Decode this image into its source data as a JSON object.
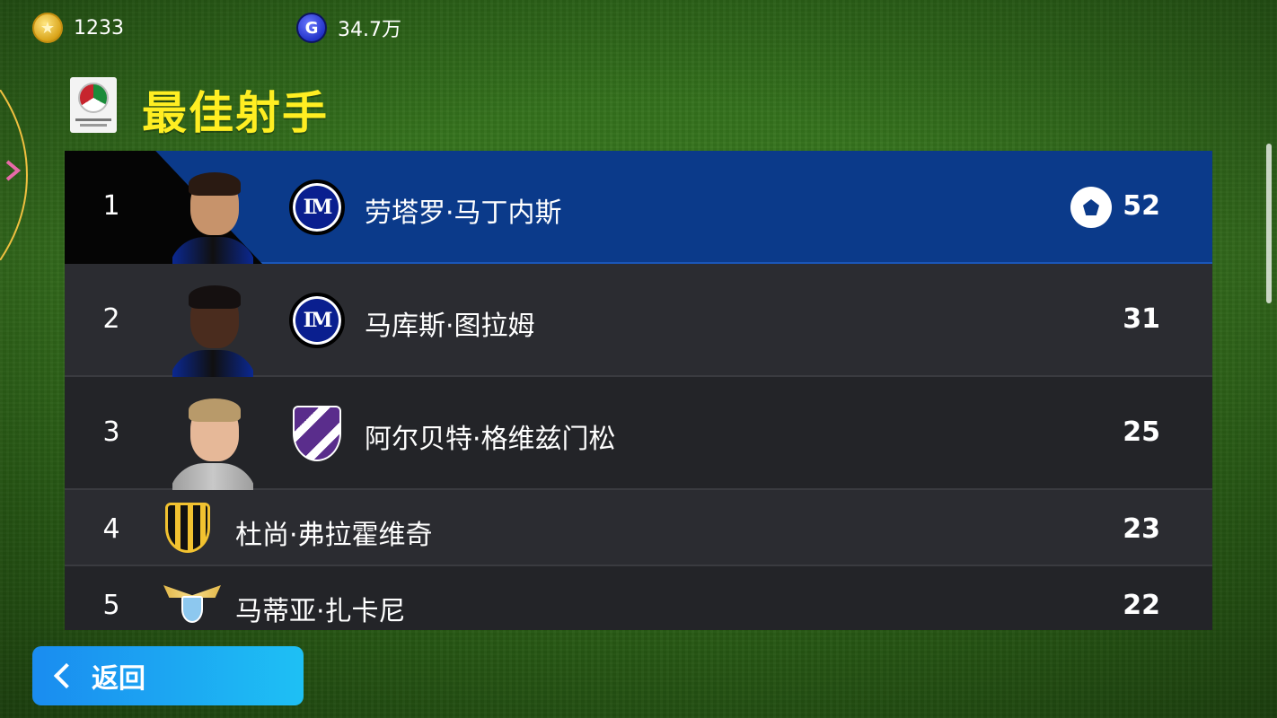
{
  "currency": {
    "gold_coins": "1233",
    "gp": "34.7万"
  },
  "header": {
    "title": "最佳射手",
    "league_logo_icon": "serie-a-logo-icon"
  },
  "table": {
    "rows": [
      {
        "rank": "1",
        "name": "劳塔罗·马丁内斯",
        "goals": "52",
        "club_icon": "inter-badge-icon",
        "highlighted": true
      },
      {
        "rank": "2",
        "name": "马库斯·图拉姆",
        "goals": "31",
        "club_icon": "inter-badge-icon"
      },
      {
        "rank": "3",
        "name": "阿尔贝特·格维兹门松",
        "goals": "25",
        "club_icon": "fiorentina-badge-icon"
      },
      {
        "rank": "4",
        "name": "杜尚·弗拉霍维奇",
        "goals": "23",
        "club_icon": "juventus-badge-icon"
      },
      {
        "rank": "5",
        "name": "马蒂亚·扎卡尼",
        "goals": "22",
        "club_icon": "lazio-badge-icon"
      }
    ]
  },
  "footer": {
    "back_label": "返回"
  },
  "colors": {
    "title_yellow": "#ffee22",
    "highlight_row": "#0b3a8a",
    "back_button": "#1ea6f2"
  }
}
